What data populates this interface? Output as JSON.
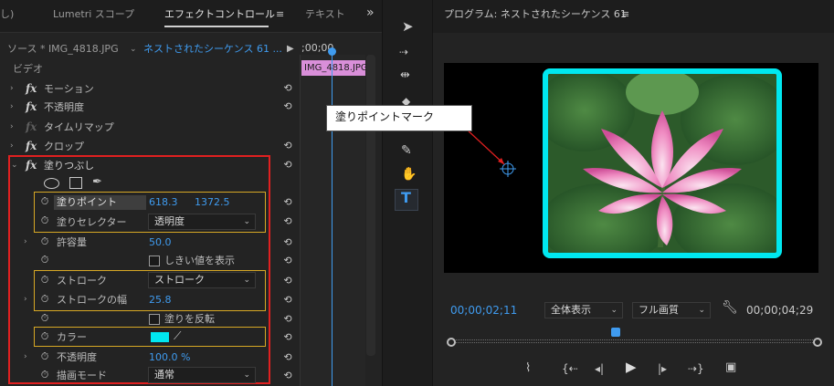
{
  "tabs": {
    "prev_partial": "し)",
    "lumetri_scope": "Lumetri スコープ",
    "effect_controls": "エフェクトコントロール",
    "effect_menu": "≡",
    "text": "テキスト",
    "overflow": "»"
  },
  "source_bar": {
    "source": "ソース * IMG_4818.JPG",
    "sequence": "ネストされたシーケンス 61 ...",
    "play": "▶",
    "timecode": ";00;00"
  },
  "clip_label": "IMG_4818.JPG",
  "video_header": "ビデオ",
  "effects": {
    "motion": "モーション",
    "opacity": "不透明度",
    "time_remap": "タイムリマップ",
    "crop": "クロップ",
    "fill": "塗りつぶし"
  },
  "fill_params": {
    "fill_point_label": "塗りポイント",
    "fill_point_x": "618.3",
    "fill_point_y": "1372.5",
    "fill_selector_label": "塗りセレクター",
    "fill_selector_value": "透明度",
    "tolerance_label": "許容量",
    "tolerance_value": "50.0",
    "show_threshold_label": "しきい値を表示",
    "stroke_label": "ストローク",
    "stroke_value": "ストローク",
    "stroke_width_label": "ストロークの幅",
    "stroke_width_value": "25.8",
    "invert_fill_label": "塗りを反転",
    "color_label": "カラー",
    "color_value": "#00e8f0",
    "opacity_label": "不透明度",
    "opacity_value": "100.0 %",
    "blend_mode_label": "描画モード",
    "blend_mode_value": "通常"
  },
  "program": {
    "title": "プログラム: ネストされたシーケンス 61",
    "menu": "≡",
    "callout": "塗りポイントマーク",
    "timecode_current": "00;00;02;11",
    "zoom_select": "全体表示",
    "quality_select": "フル画質",
    "timecode_duration": "00;00;04;29",
    "playhead_fraction": 0.45
  },
  "colors": {
    "accent_blue": "#3f9bef",
    "highlight_red": "#e02020",
    "highlight_yellow": "#d7a825",
    "clip_pink": "#d98fd9",
    "frame_cyan": "#00e8f0"
  }
}
